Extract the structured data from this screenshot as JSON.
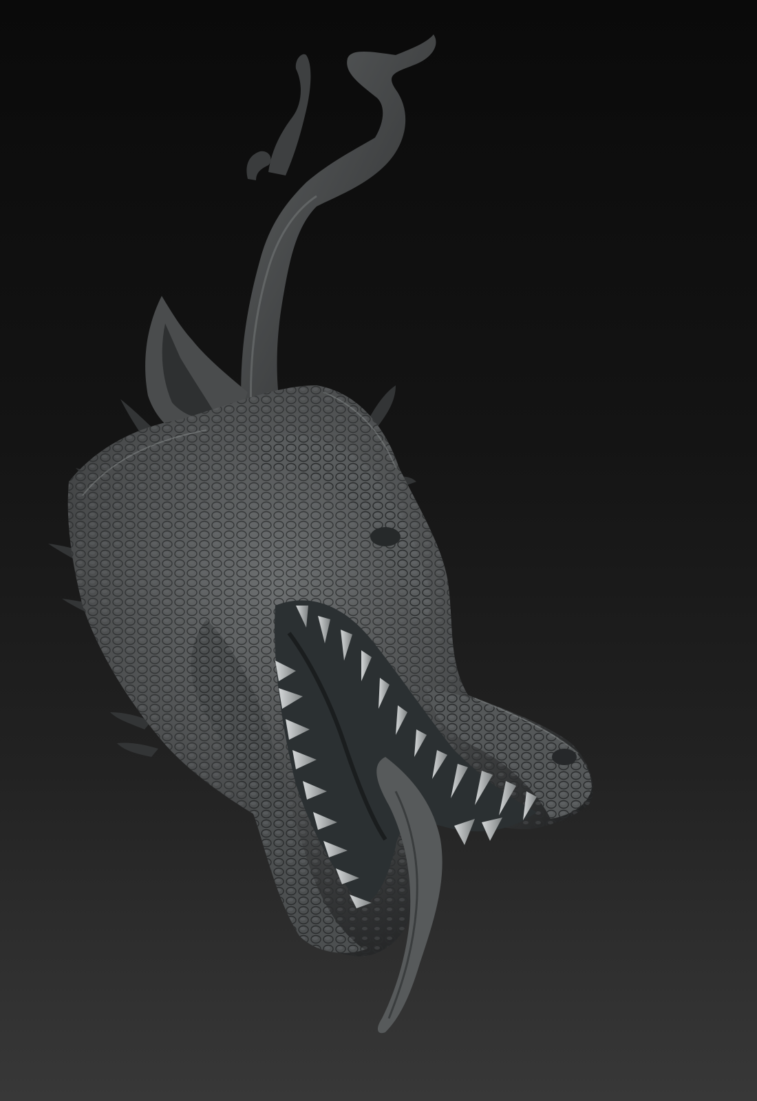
{
  "scene": {
    "subject": "dragon-head-sculpt",
    "colors": {
      "background_top": "#0a0a0a",
      "background_bottom": "#383838",
      "clay": "#4e5051",
      "clay_light": "#9fa3a5",
      "clay_dark": "#1c1d1e",
      "teeth": "#b8bcbd",
      "mouth_inner": "#2b3032"
    }
  }
}
